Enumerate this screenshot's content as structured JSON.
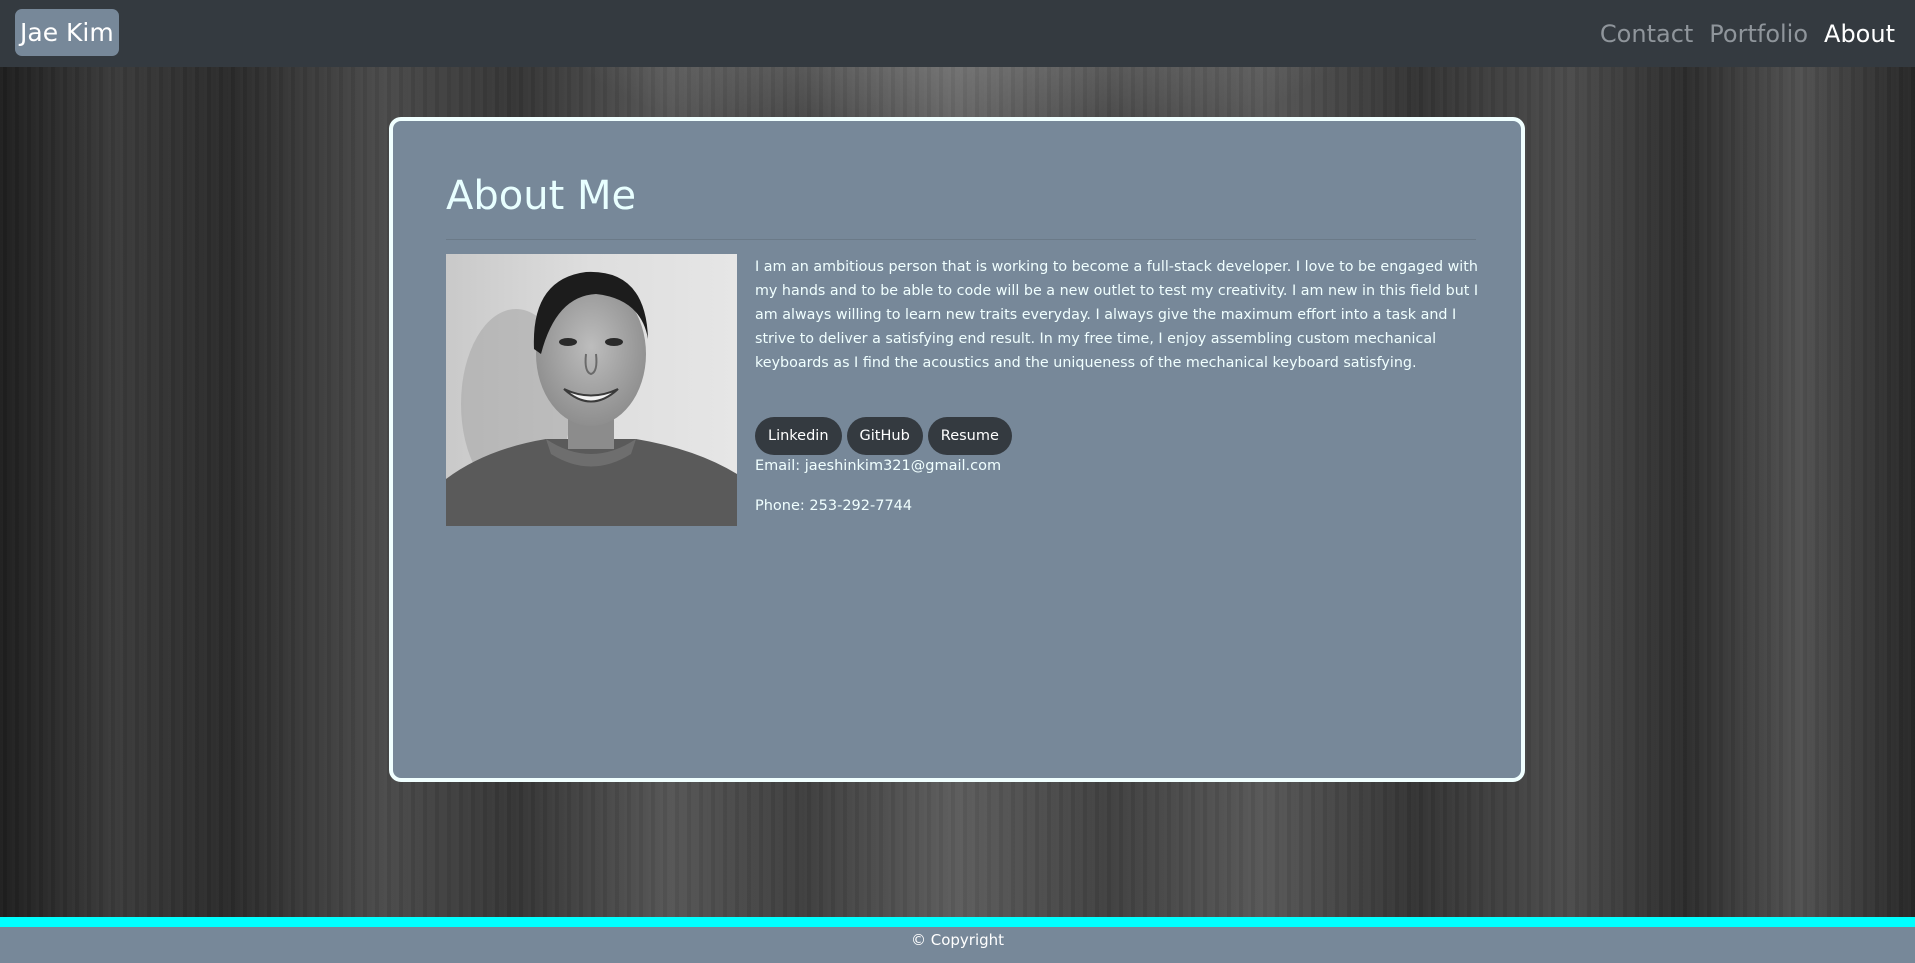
{
  "navbar": {
    "brand": "Jae Kim",
    "links": [
      {
        "label": "Contact",
        "active": false
      },
      {
        "label": "Portfolio",
        "active": false
      },
      {
        "label": "About",
        "active": true
      }
    ]
  },
  "about": {
    "title": "About Me",
    "bio": "I am an ambitious person that is working to become a full-stack developer. I love to be engaged with my hands and to be able to code will be a new outlet to test my creativity. I am new in this field but I am always willing to learn new traits everyday. I always give the maximum effort into a task and I strive to deliver a satisfying end result. In my free time, I enjoy assembling custom mechanical keyboards as I find the acoustics and the uniqueness of the mechanical keyboard satisfying.",
    "buttons": {
      "linkedin": "Linkedin",
      "github": "GitHub",
      "resume": "Resume"
    },
    "email": "Email: jaeshinkim321@gmail.com",
    "phone": "Phone: 253-292-7744"
  },
  "footer": {
    "copyright": "© Copyright"
  },
  "colors": {
    "navbar_bg": "#343a40",
    "card_bg": "#778899",
    "card_border": "#f0ffff",
    "footer_accent": "#00ffff",
    "button_bg": "#343a40"
  }
}
